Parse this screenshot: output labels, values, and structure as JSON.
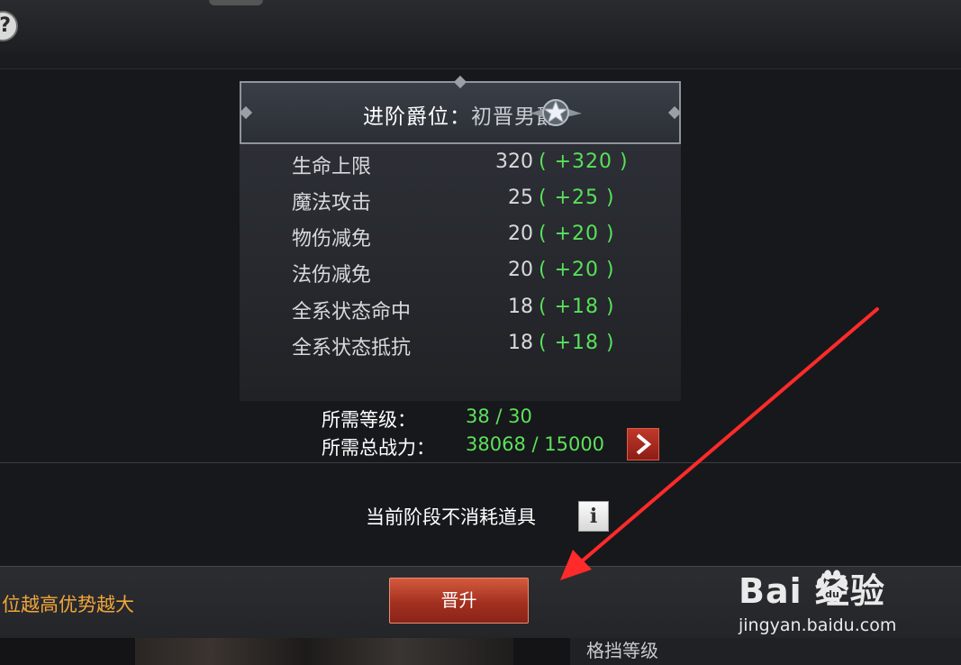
{
  "help": {
    "glyph": "?"
  },
  "panel": {
    "title_label": "进阶爵位：",
    "title_rank": "初晋男爵"
  },
  "stats": [
    {
      "name": "生命上限",
      "value": "320",
      "bonus": "( +320 )"
    },
    {
      "name": "魔法攻击",
      "value": "25",
      "bonus": "( +25 )"
    },
    {
      "name": "物伤减免",
      "value": "20",
      "bonus": "( +20 )"
    },
    {
      "name": "法伤减免",
      "value": "20",
      "bonus": "( +20 )"
    },
    {
      "name": "全系状态命中",
      "value": "18",
      "bonus": "( +18 )"
    },
    {
      "name": "全系状态抵抗",
      "value": "18",
      "bonus": "( +18 )"
    }
  ],
  "requirements": {
    "level_label": "所需等级：",
    "level_value": "38 / 30",
    "power_label": "所需总战力：",
    "power_value": "38068 / 15000"
  },
  "notice": {
    "text": "当前阶段不消耗道具",
    "info_glyph": "i"
  },
  "tip": {
    "text": "位越高优势越大"
  },
  "promote": {
    "label": "晋升"
  },
  "bottom": {
    "block_label": "格挡等级"
  },
  "watermark": {
    "brand": "Bai  经验",
    "url": "jingyan.baidu.com"
  },
  "colors": {
    "accent_green": "#58e05a",
    "button_red": "#a3301f",
    "tip_orange": "#f0a63a",
    "annotation_red": "#ff2a2a"
  },
  "icons": [
    "help-icon",
    "star-badge-icon",
    "arrow-right-icon",
    "info-icon",
    "baidu-paw-icon"
  ]
}
